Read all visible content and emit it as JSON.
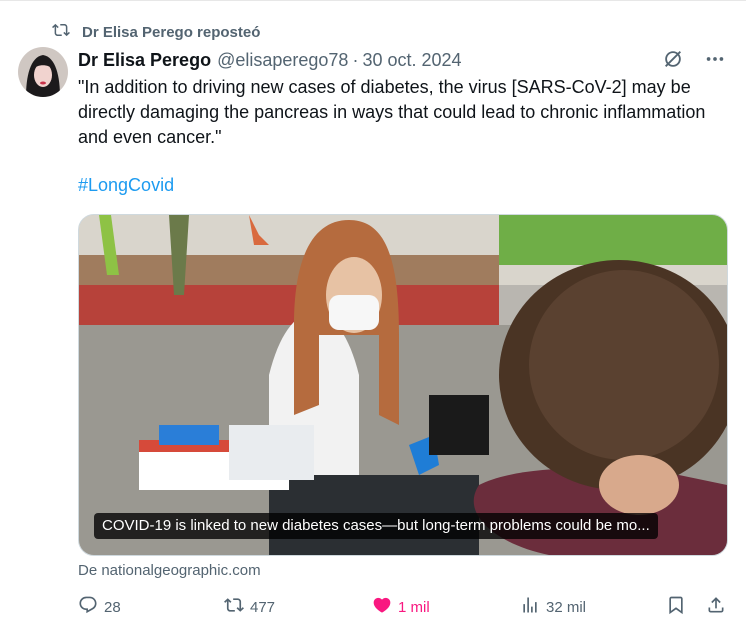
{
  "repost": {
    "label": "Dr Elisa Perego reposteó"
  },
  "tweet": {
    "author_name": "Dr Elisa Perego",
    "handle": "@elisaperego78",
    "separator": "·",
    "date": "30 oct. 2024",
    "text": "\"In addition to driving new cases of diabetes, the virus [SARS-CoV-2] may be directly damaging the pancreas in ways that could lead to chronic inflammation and even cancer.\"",
    "hashtag": "#LongCovid",
    "media_caption": "COVID-19 is linked to new diabetes cases—but long-term problems could be mo...",
    "source": "De nationalgeographic.com"
  },
  "actions": {
    "replies": "28",
    "reposts": "477",
    "likes": "1 mil",
    "views": "32 mil"
  },
  "colors": {
    "accent": "#1d9bf0",
    "like": "#f91880",
    "secondary_text": "#536471"
  },
  "icons": [
    "repost-icon",
    "grok-icon",
    "more-icon",
    "reply-icon",
    "like-icon",
    "views-icon",
    "bookmark-icon",
    "share-icon"
  ]
}
